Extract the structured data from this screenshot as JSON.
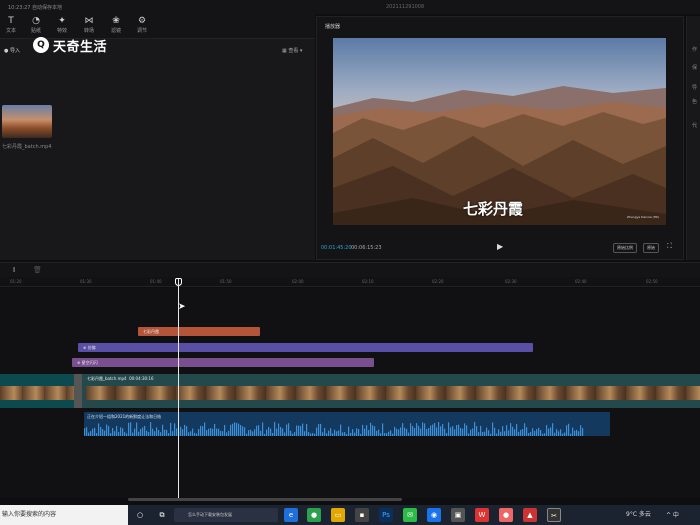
{
  "window": {
    "title": "10:23:27 自动保存本地",
    "date": "202111291008"
  },
  "toolbar": {
    "items": [
      {
        "label": "文本",
        "icon": "text-icon"
      },
      {
        "label": "贴纸",
        "icon": "sticker-icon"
      },
      {
        "label": "特效",
        "icon": "effects-icon"
      },
      {
        "label": "转场",
        "icon": "transition-icon"
      },
      {
        "label": "滤镜",
        "icon": "filter-icon"
      },
      {
        "label": "调节",
        "icon": "adjust-icon"
      }
    ]
  },
  "watermark": {
    "logo": "Q",
    "text": "天奇生活"
  },
  "media": {
    "import_label": "导入",
    "sort_label": "查看",
    "item_label": "七彩丹霞_batch.mp4"
  },
  "player": {
    "title": "播放器",
    "caption": "七彩丹霞",
    "credit": "Zhangye Danxia (HK)",
    "current_time": "00:01:45:20",
    "total_time": "00:06:15:23",
    "ratio_label": "原始比例",
    "original_label": "原始"
  },
  "props": {
    "labels": [
      "作",
      "保",
      "导",
      "色",
      "代"
    ]
  },
  "ruler": {
    "ticks": [
      "01:20",
      "01:30",
      "01:40",
      "01:50",
      "02:00",
      "02:10",
      "02:20",
      "02:30",
      "02:40",
      "02:50"
    ]
  },
  "tracks": {
    "text_clip": "七彩丹霞",
    "filter_clip": "⊕ 仿佛",
    "effect_clip": "⊕ 星空闪闪",
    "video_clip": "七彩丹霞_batch.mp4",
    "video_duration": "00:04:30:16",
    "audio_clip": "正在介绍一组和2021的新鲜度让法和日结"
  },
  "taskbar": {
    "search_text": "输入你要搜索的内容",
    "ad_text": "怎么手动下载安装包发展",
    "weather": "9°C 多云",
    "tray": "^ 中"
  },
  "colors": {
    "text_clip": "#b4553a",
    "filter_clip": "#5a4fa6",
    "effect_clip": "#7a4f8f",
    "video_track": "#0c4a4f",
    "audio_clip": "#14395e",
    "accent": "#2fa6c9"
  }
}
